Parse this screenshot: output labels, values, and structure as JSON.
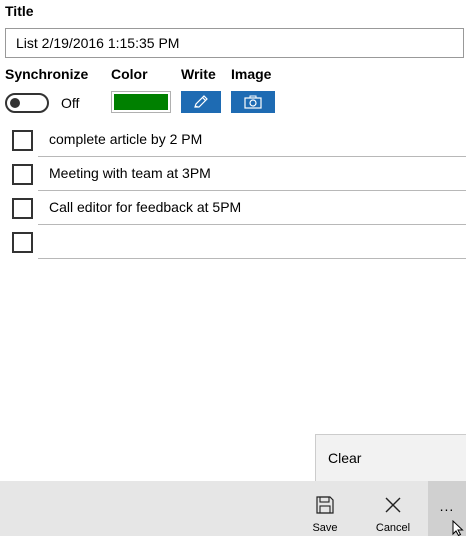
{
  "title_section": {
    "label": "Title",
    "value": "List 2/19/2016 1:15:35 PM"
  },
  "headers": {
    "synchronize": "Synchronize",
    "color": "Color",
    "write": "Write",
    "image": "Image"
  },
  "synchronize": {
    "state_text": "Off",
    "on": false
  },
  "color": {
    "value": "#008000"
  },
  "write_button": {
    "icon": "pencil-icon",
    "bg": "#1e6bb3"
  },
  "image_button": {
    "icon": "camera-icon",
    "bg": "#1e6bb3"
  },
  "items": [
    {
      "text": "complete article by 2 PM",
      "checked": false
    },
    {
      "text": "Meeting with team at 3PM",
      "checked": false
    },
    {
      "text": "Call editor for feedback at 5PM",
      "checked": false
    },
    {
      "text": "",
      "checked": false
    }
  ],
  "flyout": {
    "clear_label": "Clear"
  },
  "appbar": {
    "save_label": "Save",
    "save_icon": "save-icon",
    "cancel_label": "Cancel",
    "cancel_icon": "close-icon",
    "more_label": "...",
    "more_icon": "more-icon"
  }
}
